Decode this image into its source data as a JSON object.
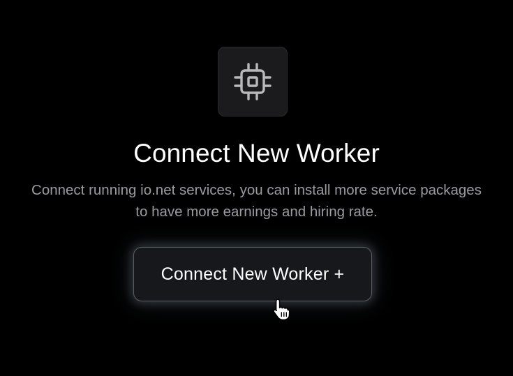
{
  "icon": {
    "name": "cpu-chip-icon"
  },
  "header": {
    "title": "Connect New Worker",
    "subtitle": "Connect running io.net services, you can install more service packages to have more earnings and hiring rate."
  },
  "actions": {
    "connect_label": "Connect New Worker +"
  },
  "cursor": {
    "name": "hand-pointer-icon"
  },
  "colors": {
    "background": "#000000",
    "title": "#ffffff",
    "subtitle": "#9a9aa0",
    "icon_stroke": "#b9b9bd",
    "button_bg": "#16181b",
    "button_border": "#5a5f66"
  }
}
